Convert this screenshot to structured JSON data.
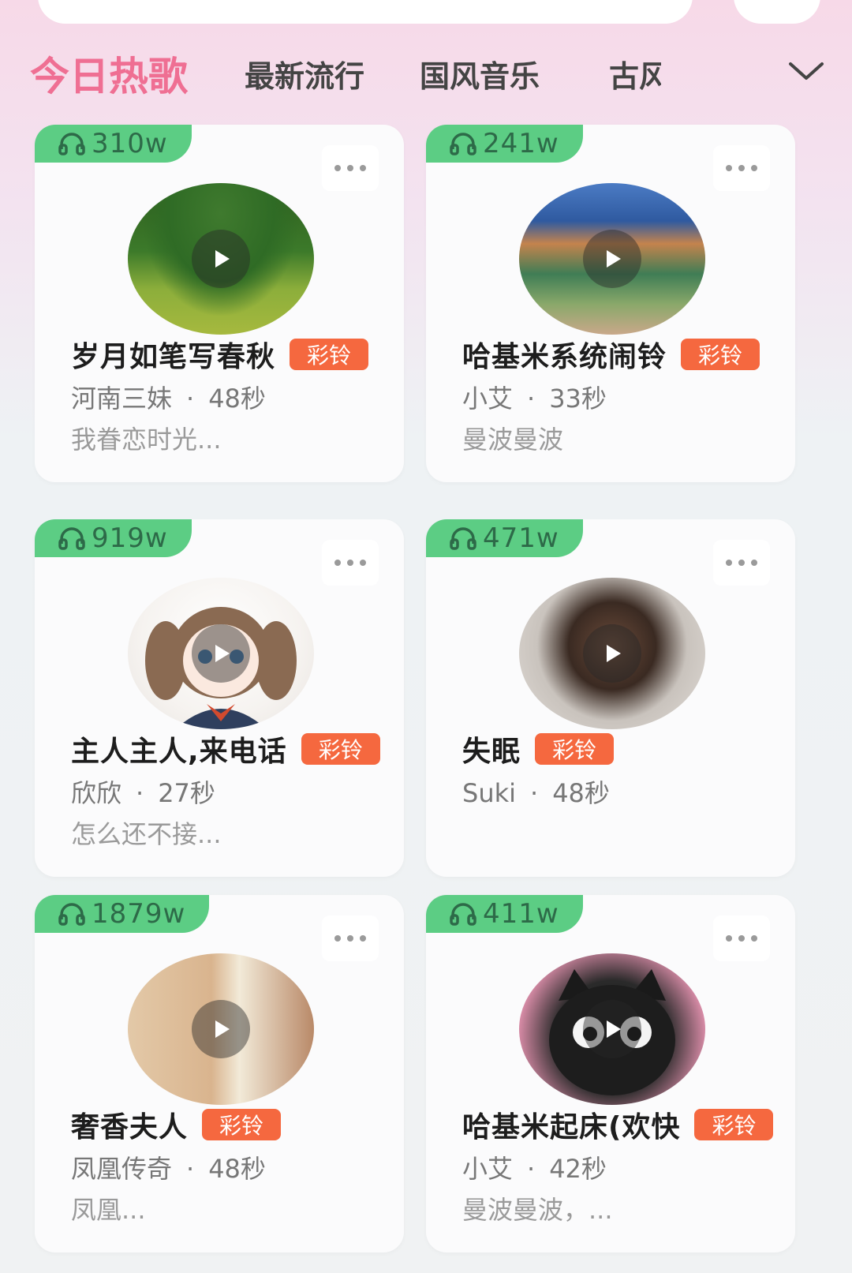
{
  "tabs": {
    "items": [
      "今日热歌",
      "最新流行",
      "国风音乐",
      "古风"
    ],
    "active_index": 0
  },
  "cards": [
    {
      "plays": "310w",
      "title": "岁月如笔写春秋",
      "badge": "彩铃",
      "artist": "河南三妹",
      "dot": "·",
      "duration": "48秒",
      "lyric": "我眷恋时光..."
    },
    {
      "plays": "241w",
      "title": "哈基米系统闹铃",
      "badge": "彩铃",
      "artist": "小艾",
      "dot": "·",
      "duration": "33秒",
      "lyric": "曼波曼波"
    },
    {
      "plays": "919w",
      "title": "主人主人,来电话",
      "badge": "彩铃",
      "artist": "欣欣",
      "dot": "·",
      "duration": "27秒",
      "lyric": "怎么还不接..."
    },
    {
      "plays": "471w",
      "title": "失眠",
      "badge": "彩铃",
      "artist": "Suki",
      "dot": "·",
      "duration": "48秒",
      "lyric": ""
    },
    {
      "plays": "1879w",
      "title": "奢香夫人",
      "badge": "彩铃",
      "artist": "凤凰传奇",
      "dot": "·",
      "duration": "48秒",
      "lyric": "凤凰..."
    },
    {
      "plays": "411w",
      "title": "哈基米起床(欢快",
      "badge": "彩铃",
      "artist": "小艾",
      "dot": "·",
      "duration": "42秒",
      "lyric": "曼波曼波，..."
    }
  ],
  "colors": {
    "accent_tab": "#ef6f93",
    "plays_badge": "#5ccd84",
    "ringtone_badge": "#f5683f"
  },
  "icons": {
    "plays": "headphones-icon",
    "more": "more-dots-icon",
    "play": "play-icon",
    "tab_expand": "chevron-down-icon"
  }
}
